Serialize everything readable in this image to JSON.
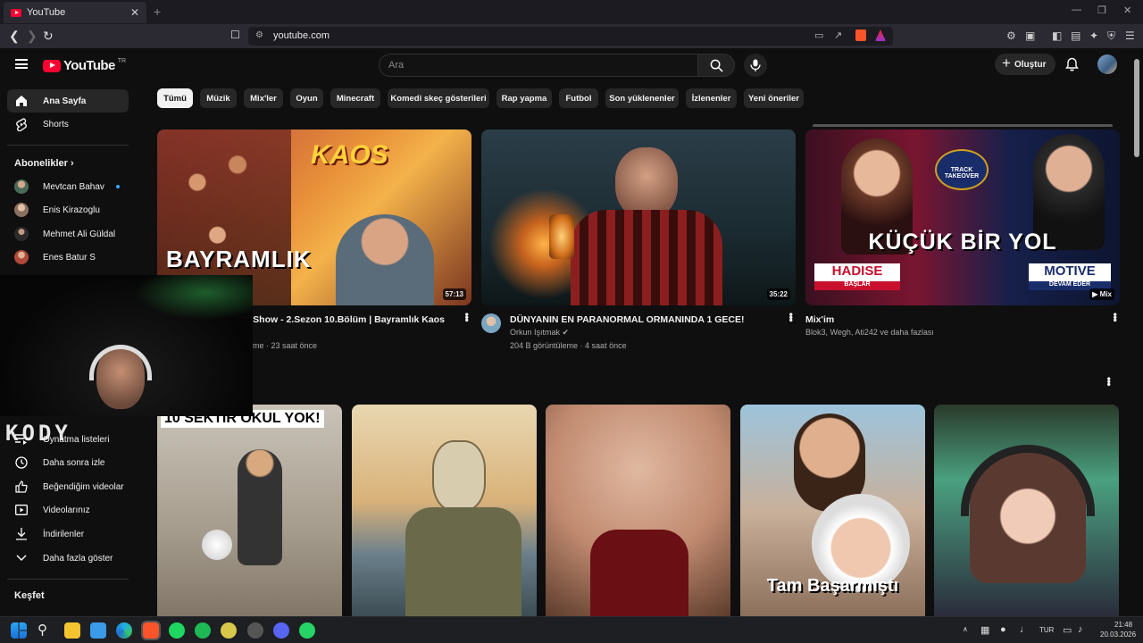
{
  "browser": {
    "tab_title": "YouTube",
    "tab_close": "✕",
    "new_tab": "+",
    "url": "youtube.com",
    "window_controls": [
      "—",
      "❐",
      "✕"
    ]
  },
  "header": {
    "logo_text": "YouTube",
    "country_code": "TR",
    "search_placeholder": "Ara",
    "create_label": "Oluştur"
  },
  "sidebar": {
    "primary": [
      {
        "label": "Ana Sayfa",
        "icon": "home-icon"
      },
      {
        "label": "Shorts",
        "icon": "shorts-icon"
      }
    ],
    "subscriptions_title": "Abonelikler",
    "subscriptions": [
      {
        "label": "Mevtcan Bahav",
        "color": "#4a6b5a",
        "new": true
      },
      {
        "label": "Enis Kirazoglu",
        "color": "#8a7060",
        "new": false
      },
      {
        "label": "Mehmet Ali Güldal",
        "color": "#2a2a2a",
        "new": false
      },
      {
        "label": "Enes Batur S",
        "color": "#b04a3a",
        "new": false
      }
    ],
    "you_items": [
      {
        "label": "Oynatma listeleri",
        "icon": "playlist-icon"
      },
      {
        "label": "Daha sonra izle",
        "icon": "clock-icon"
      },
      {
        "label": "Beğendiğim videolar",
        "icon": "thumbs-up-icon"
      },
      {
        "label": "Videolarınız",
        "icon": "video-icon"
      },
      {
        "label": "İndirilenler",
        "icon": "download-icon"
      },
      {
        "label": "Daha fazla göster",
        "icon": "chevron-down-icon"
      }
    ],
    "explore_title": "Keşfet"
  },
  "chips": [
    "Tümü",
    "Müzik",
    "Mix'ler",
    "Oyun",
    "Minecraft",
    "Komedi skeç gösterileri",
    "Rap yapma",
    "Futbol",
    "Son yüklenenler",
    "İzlenenler",
    "Yeni öneriler"
  ],
  "videos": [
    {
      "title": "os Show - 2.Sezon 10.Bölüm | Bayramlık Kaos",
      "channel": "",
      "meta": "me · 23 saat önce",
      "duration": "57:13",
      "thumb_text": "BAYRAMLIK",
      "thumb_logo": "KAOS"
    },
    {
      "title": "DÜNYANIN EN PARANORMAL ORMANINDA 1 GECE!",
      "channel": "Orkun Işıtmak ✔",
      "meta": "204 B görüntüleme · 4 saat önce",
      "duration": "35:22"
    },
    {
      "title": "Mix'im",
      "channel": "Blok3, Wegh, Ati242 ve daha fazlası",
      "meta": "",
      "duration": "Mix",
      "thumb_text": "KÜÇÜK BİR YOL",
      "thumb_left": "HADISE",
      "thumb_left_sub": "BAŞLAR",
      "thumb_right": "MOTIVE",
      "thumb_right_sub": "DEVAM EDER",
      "thumb_badge": "TRACK TAKEOVER"
    }
  ],
  "shorts": [
    {
      "overlay": "10 SEKTİR OKUL YOK!"
    },
    {
      "overlay": ""
    },
    {
      "overlay": ""
    },
    {
      "overlay": "Tam Başarmıştı"
    },
    {
      "overlay": ""
    }
  ],
  "webcam": {
    "brand": "KODY"
  },
  "taskbar": {
    "lang": "TUR",
    "time": "21:48",
    "date": "20.03.2026"
  }
}
